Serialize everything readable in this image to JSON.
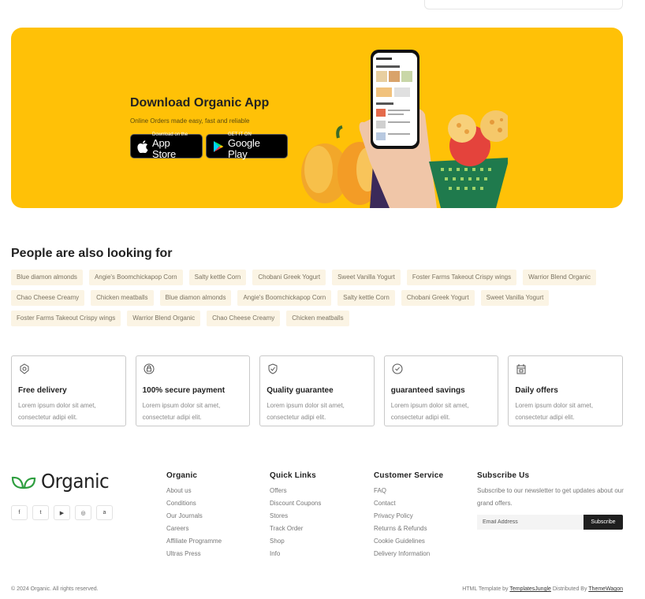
{
  "banner": {
    "title": "Download Organic App",
    "subtitle": "Online Orders made easy, fast and reliable",
    "app_store": {
      "small": "Download on the",
      "big": "App Store"
    },
    "google_play": {
      "small": "GET IT ON",
      "big": "Google Play"
    },
    "phone_screen": {
      "back": "< Collections",
      "breakfast": "Breakfast & more",
      "mix": "Mix To Try"
    }
  },
  "tags_section": {
    "title": "People are also looking for",
    "tags": [
      "Blue diamon almonds",
      "Angie's Boomchickapop Corn",
      "Salty kettle Corn",
      "Chobani Greek Yogurt",
      "Sweet Vanilla Yogurt",
      "Foster Farms Takeout Crispy wings",
      "Warrior Blend Organic",
      "Chao Cheese Creamy",
      "Chicken meatballs",
      "Blue diamon almonds",
      "Angie's Boomchickapop Corn",
      "Salty kettle Corn",
      "Chobani Greek Yogurt",
      "Sweet Vanilla Yogurt",
      "Foster Farms Takeout Crispy wings",
      "Warrior Blend Organic",
      "Chao Cheese Creamy",
      "Chicken meatballs"
    ]
  },
  "features": [
    {
      "icon": "delivery-icon",
      "title": "Free delivery",
      "text": "Lorem ipsum dolor sit amet, consectetur adipi elit."
    },
    {
      "icon": "secure-payment-icon",
      "title": "100% secure payment",
      "text": "Lorem ipsum dolor sit amet, consectetur adipi elit."
    },
    {
      "icon": "quality-shield-icon",
      "title": "Quality guarantee",
      "text": "Lorem ipsum dolor sit amet, consectetur adipi elit."
    },
    {
      "icon": "savings-icon",
      "title": "guaranteed savings",
      "text": "Lorem ipsum dolor sit amet, consectetur adipi elit."
    },
    {
      "icon": "offers-icon",
      "title": "Daily offers",
      "text": "Lorem ipsum dolor sit amet, consectetur adipi elit."
    }
  ],
  "footer": {
    "logo_text": "Organic",
    "socials": [
      "f",
      "t",
      "▶",
      "◎",
      "a"
    ],
    "columns": [
      {
        "title": "Organic",
        "links": [
          "About us",
          "Conditions",
          "Our Journals",
          "Careers",
          "Affiliate Programme",
          "Ultras Press"
        ]
      },
      {
        "title": "Quick Links",
        "links": [
          "Offers",
          "Discount Coupons",
          "Stores",
          "Track Order",
          "Shop",
          "Info"
        ]
      },
      {
        "title": "Customer Service",
        "links": [
          "FAQ",
          "Contact",
          "Privacy Policy",
          "Returns & Refunds",
          "Cookie Guidelines",
          "Delivery Information"
        ]
      }
    ],
    "subscribe": {
      "title": "Subscribe Us",
      "text": "Subscribe to our newsletter to get updates about our grand offers.",
      "placeholder": "Email Address",
      "button": "Subscribe"
    },
    "copyright": "© 2024 Organic. All rights reserved.",
    "credits_prefix": "HTML Template by",
    "credits_link1": "TemplatesJungle",
    "credits_mid": "Distributed By",
    "credits_link2": "ThemeWagon"
  },
  "colors": {
    "banner": "#ffc107",
    "tag_bg": "#fbf4e4",
    "brand_green": "#2e9e3f",
    "button_dark": "#1f1f1f"
  }
}
